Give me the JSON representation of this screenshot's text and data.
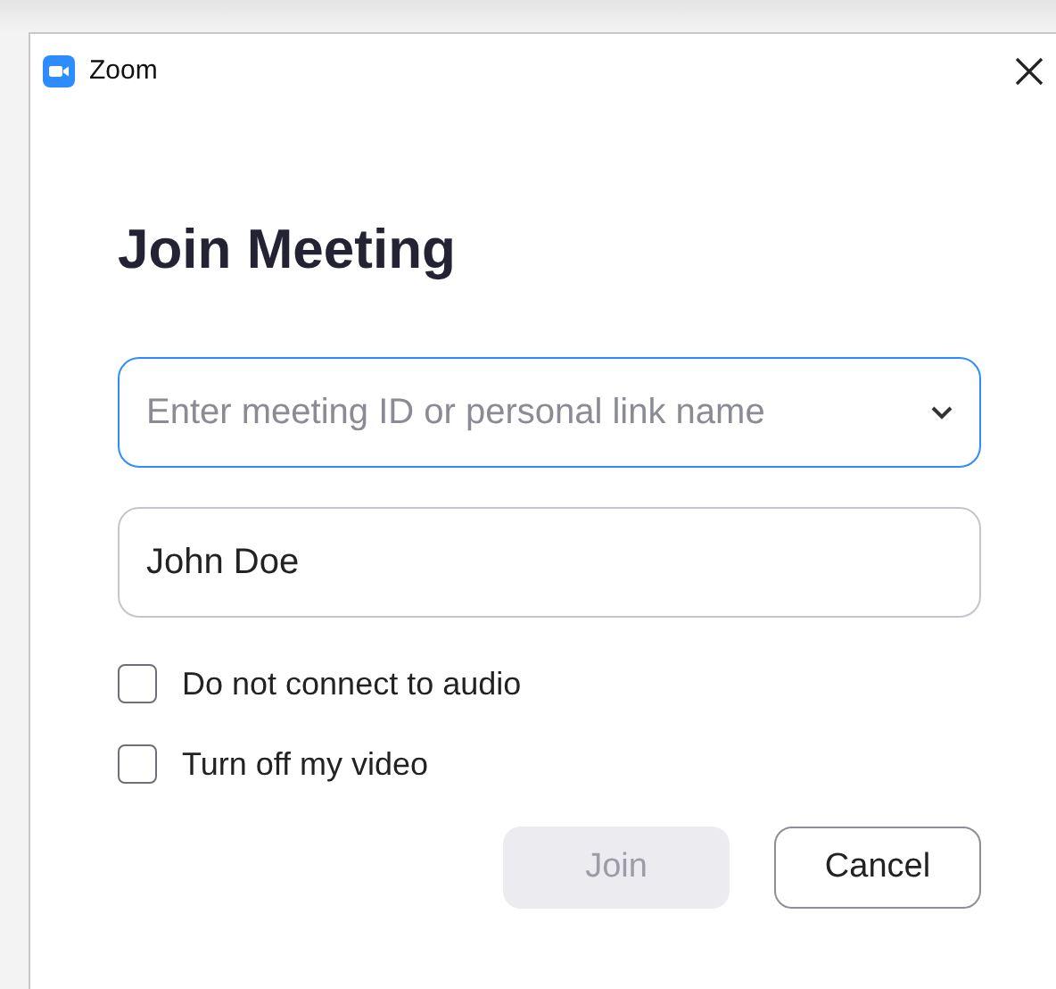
{
  "window": {
    "title": "Zoom"
  },
  "heading": "Join Meeting",
  "meeting_field": {
    "placeholder": "Enter meeting ID or personal link name",
    "focused": true
  },
  "name_field": {
    "value": "John Doe",
    "focused": false
  },
  "options": [
    {
      "label": "Do not connect to audio",
      "checked": false
    },
    {
      "label": "Turn off my video",
      "checked": false
    }
  ],
  "buttons": [
    {
      "label": "Join",
      "kind": "primary",
      "disabled": true
    },
    {
      "label": "Cancel",
      "kind": "secondary",
      "disabled": false
    }
  ]
}
